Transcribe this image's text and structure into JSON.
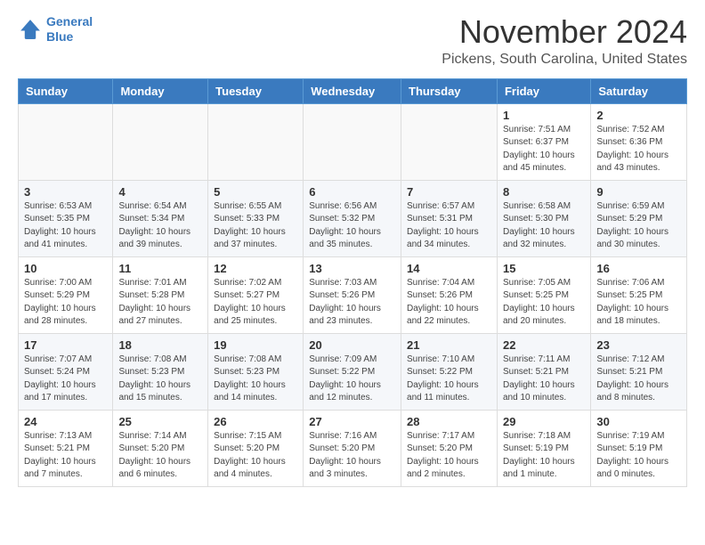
{
  "header": {
    "logo_line1": "General",
    "logo_line2": "Blue",
    "month": "November 2024",
    "location": "Pickens, South Carolina, United States"
  },
  "days_of_week": [
    "Sunday",
    "Monday",
    "Tuesday",
    "Wednesday",
    "Thursday",
    "Friday",
    "Saturday"
  ],
  "weeks": [
    [
      {
        "day": "",
        "info": ""
      },
      {
        "day": "",
        "info": ""
      },
      {
        "day": "",
        "info": ""
      },
      {
        "day": "",
        "info": ""
      },
      {
        "day": "",
        "info": ""
      },
      {
        "day": "1",
        "info": "Sunrise: 7:51 AM\nSunset: 6:37 PM\nDaylight: 10 hours and 45 minutes."
      },
      {
        "day": "2",
        "info": "Sunrise: 7:52 AM\nSunset: 6:36 PM\nDaylight: 10 hours and 43 minutes."
      }
    ],
    [
      {
        "day": "3",
        "info": "Sunrise: 6:53 AM\nSunset: 5:35 PM\nDaylight: 10 hours and 41 minutes."
      },
      {
        "day": "4",
        "info": "Sunrise: 6:54 AM\nSunset: 5:34 PM\nDaylight: 10 hours and 39 minutes."
      },
      {
        "day": "5",
        "info": "Sunrise: 6:55 AM\nSunset: 5:33 PM\nDaylight: 10 hours and 37 minutes."
      },
      {
        "day": "6",
        "info": "Sunrise: 6:56 AM\nSunset: 5:32 PM\nDaylight: 10 hours and 35 minutes."
      },
      {
        "day": "7",
        "info": "Sunrise: 6:57 AM\nSunset: 5:31 PM\nDaylight: 10 hours and 34 minutes."
      },
      {
        "day": "8",
        "info": "Sunrise: 6:58 AM\nSunset: 5:30 PM\nDaylight: 10 hours and 32 minutes."
      },
      {
        "day": "9",
        "info": "Sunrise: 6:59 AM\nSunset: 5:29 PM\nDaylight: 10 hours and 30 minutes."
      }
    ],
    [
      {
        "day": "10",
        "info": "Sunrise: 7:00 AM\nSunset: 5:29 PM\nDaylight: 10 hours and 28 minutes."
      },
      {
        "day": "11",
        "info": "Sunrise: 7:01 AM\nSunset: 5:28 PM\nDaylight: 10 hours and 27 minutes."
      },
      {
        "day": "12",
        "info": "Sunrise: 7:02 AM\nSunset: 5:27 PM\nDaylight: 10 hours and 25 minutes."
      },
      {
        "day": "13",
        "info": "Sunrise: 7:03 AM\nSunset: 5:26 PM\nDaylight: 10 hours and 23 minutes."
      },
      {
        "day": "14",
        "info": "Sunrise: 7:04 AM\nSunset: 5:26 PM\nDaylight: 10 hours and 22 minutes."
      },
      {
        "day": "15",
        "info": "Sunrise: 7:05 AM\nSunset: 5:25 PM\nDaylight: 10 hours and 20 minutes."
      },
      {
        "day": "16",
        "info": "Sunrise: 7:06 AM\nSunset: 5:25 PM\nDaylight: 10 hours and 18 minutes."
      }
    ],
    [
      {
        "day": "17",
        "info": "Sunrise: 7:07 AM\nSunset: 5:24 PM\nDaylight: 10 hours and 17 minutes."
      },
      {
        "day": "18",
        "info": "Sunrise: 7:08 AM\nSunset: 5:23 PM\nDaylight: 10 hours and 15 minutes."
      },
      {
        "day": "19",
        "info": "Sunrise: 7:08 AM\nSunset: 5:23 PM\nDaylight: 10 hours and 14 minutes."
      },
      {
        "day": "20",
        "info": "Sunrise: 7:09 AM\nSunset: 5:22 PM\nDaylight: 10 hours and 12 minutes."
      },
      {
        "day": "21",
        "info": "Sunrise: 7:10 AM\nSunset: 5:22 PM\nDaylight: 10 hours and 11 minutes."
      },
      {
        "day": "22",
        "info": "Sunrise: 7:11 AM\nSunset: 5:21 PM\nDaylight: 10 hours and 10 minutes."
      },
      {
        "day": "23",
        "info": "Sunrise: 7:12 AM\nSunset: 5:21 PM\nDaylight: 10 hours and 8 minutes."
      }
    ],
    [
      {
        "day": "24",
        "info": "Sunrise: 7:13 AM\nSunset: 5:21 PM\nDaylight: 10 hours and 7 minutes."
      },
      {
        "day": "25",
        "info": "Sunrise: 7:14 AM\nSunset: 5:20 PM\nDaylight: 10 hours and 6 minutes."
      },
      {
        "day": "26",
        "info": "Sunrise: 7:15 AM\nSunset: 5:20 PM\nDaylight: 10 hours and 4 minutes."
      },
      {
        "day": "27",
        "info": "Sunrise: 7:16 AM\nSunset: 5:20 PM\nDaylight: 10 hours and 3 minutes."
      },
      {
        "day": "28",
        "info": "Sunrise: 7:17 AM\nSunset: 5:20 PM\nDaylight: 10 hours and 2 minutes."
      },
      {
        "day": "29",
        "info": "Sunrise: 7:18 AM\nSunset: 5:19 PM\nDaylight: 10 hours and 1 minute."
      },
      {
        "day": "30",
        "info": "Sunrise: 7:19 AM\nSunset: 5:19 PM\nDaylight: 10 hours and 0 minutes."
      }
    ]
  ]
}
